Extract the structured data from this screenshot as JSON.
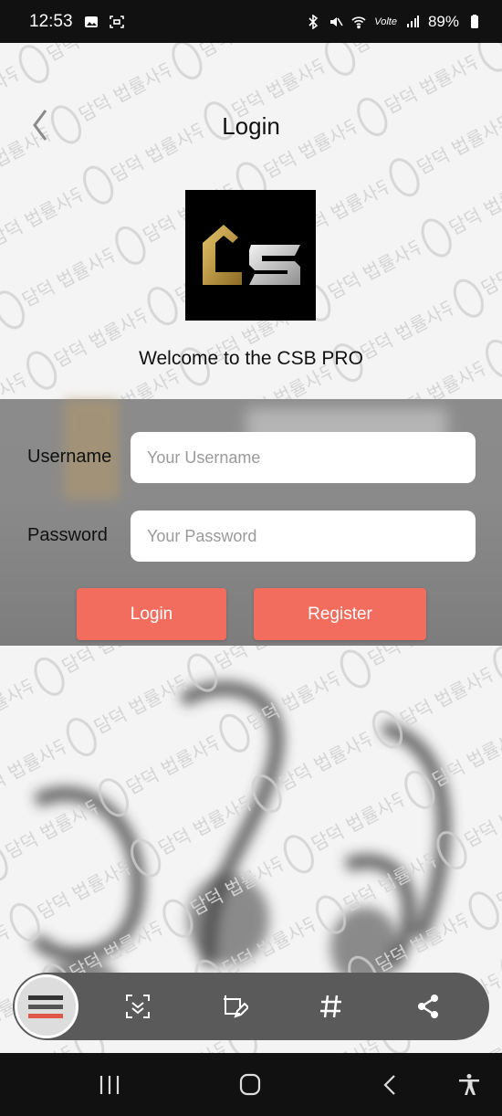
{
  "status": {
    "time": "12:53",
    "battery": "89%",
    "network_label": "Volte"
  },
  "header": {
    "title": "Login"
  },
  "logo": {
    "text": "CS",
    "accent_gold": "#c9a24a",
    "accent_silver": "#c9c9c9"
  },
  "welcome": "Welcome to the CSB PRO",
  "form": {
    "username_label": "Username",
    "username_placeholder": "Your Username",
    "password_label": "Password",
    "password_placeholder": "Your Password"
  },
  "buttons": {
    "login": "Login",
    "register": "Register"
  },
  "colors": {
    "button": "#f26d5e",
    "status_bar": "#111111"
  },
  "toolbar": {
    "items": [
      "scan-icon",
      "edit-icon",
      "hashtag-icon",
      "share-icon"
    ]
  },
  "watermark": "담덕 법률사무소"
}
